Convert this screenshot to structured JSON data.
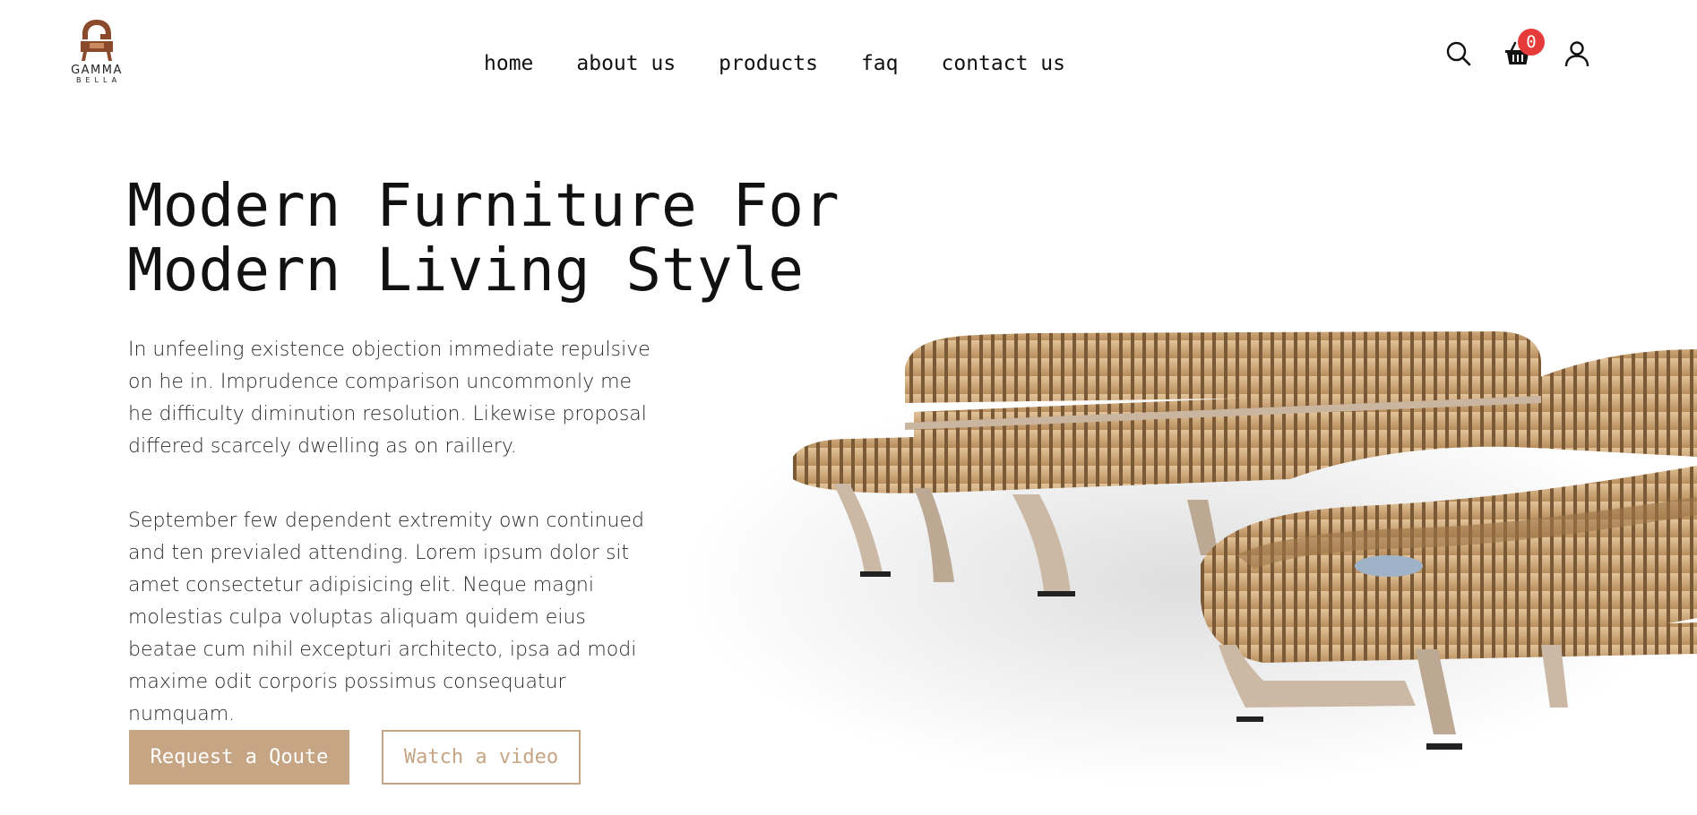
{
  "brand": {
    "name": "GAMMA",
    "subname": "BELLA",
    "logo_color": "#8b4a2b"
  },
  "nav": {
    "items": [
      {
        "label": "home"
      },
      {
        "label": "about us"
      },
      {
        "label": "products"
      },
      {
        "label": "faq"
      },
      {
        "label": "contact us"
      }
    ]
  },
  "header_actions": {
    "search_icon": "search-icon",
    "cart_icon": "basket-icon",
    "cart_count": "0",
    "user_icon": "user-icon",
    "badge_color": "#e63b3b"
  },
  "hero": {
    "title_line1": "Modern Furniture For",
    "title_line2": "Modern Living Style",
    "paragraph1": "In unfeeling existence objection immediate repulsive on he in. Imprudence comparison uncommonly me he difficulty diminution resolution. Likewise proposal differed scarcely dwelling as on raillery.",
    "paragraph2": "September few dependent extremity own continued and ten previaled attending. Lorem ipsum dolor sit amet consectetur adipisicing elit. Neque magni molestias culpa voluptas aliquam quidem eius beatae cum nihil excepturi architecto, ipsa ad modi maxime odit corporis possimus consequatur numquam.",
    "primary_button": "Request a Qoute",
    "secondary_button": "Watch a video",
    "accent_color": "#c6a584"
  }
}
